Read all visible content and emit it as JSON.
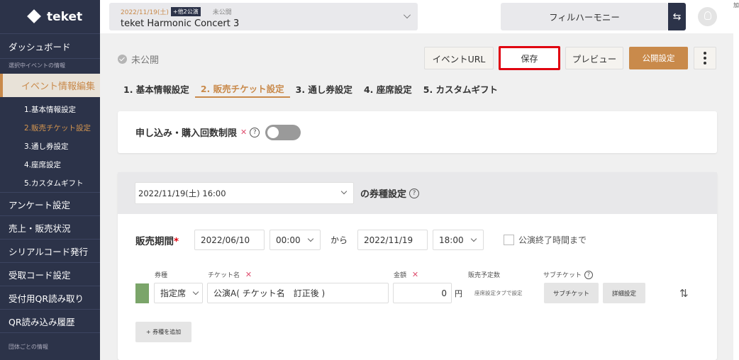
{
  "brand": {
    "name": "teket"
  },
  "sidebar": {
    "dashboard": "ダッシュボード",
    "section_selected_event": "選択中イベントの情報",
    "active_item": "イベント情報編集",
    "sub_items": [
      "1.基本情報設定",
      "2.販売チケット設定",
      "3.通し券設定",
      "4.座席設定",
      "5.カスタムギフト"
    ],
    "items": [
      "アンケート設定",
      "売上・販売状況",
      "シリアルコード発行",
      "受取コード設定",
      "受付用QR読み取り",
      "QR読み込み履歴"
    ],
    "section_group": "団体ごとの情報"
  },
  "topbar": {
    "event_date": "2022/11/19(土)",
    "event_badge": "+他2公演",
    "event_status": "未公開",
    "event_name": "teket Harmonic Concert 3",
    "org_name": "フィルハーモニー",
    "swap_symbol": "⇆",
    "edge_text": "加"
  },
  "page": {
    "status": "未公開",
    "buttons": {
      "event_url": "イベントURL",
      "save": "保存",
      "preview": "プレビュー",
      "publish": "公開設定"
    },
    "tabs": [
      "1. 基本情報設定",
      "2. 販売チケット設定",
      "3. 通し券設定",
      "4. 座席設定",
      "5. カスタムギフト"
    ],
    "active_tab_index": 1
  },
  "limit_card": {
    "label": "申し込み・購入回数制限",
    "x_mark": "✕",
    "help": "?",
    "toggle_on": false
  },
  "ticket_card": {
    "date_select": "2022/11/19(土) 16:00",
    "setting_label": "の券種設定",
    "help": "?",
    "period_label": "販売期間",
    "required_mark": "*",
    "start_date": "2022/06/10",
    "start_time": "00:00",
    "from_text": "から",
    "end_date": "2022/11/19",
    "end_time": "18:00",
    "until_end_label": "公演終了時間まで",
    "headers": {
      "type": "券種",
      "ticket_name": "チケット名",
      "amount": "金額",
      "plan_count": "販売予定数",
      "sub_ticket": "サブチケット"
    },
    "row": {
      "color": "#7ba56a",
      "type": "指定席",
      "ticket_name": "公演A( チケット名　訂正後 )",
      "amount": "0",
      "yen": "円",
      "plan_text": "座席設定タブで設定",
      "sub_ticket_btn": "サブチケット",
      "detail_btn": "詳細設定",
      "sort_symbol": "⇅"
    },
    "add_button": "+ 券種を追加"
  }
}
